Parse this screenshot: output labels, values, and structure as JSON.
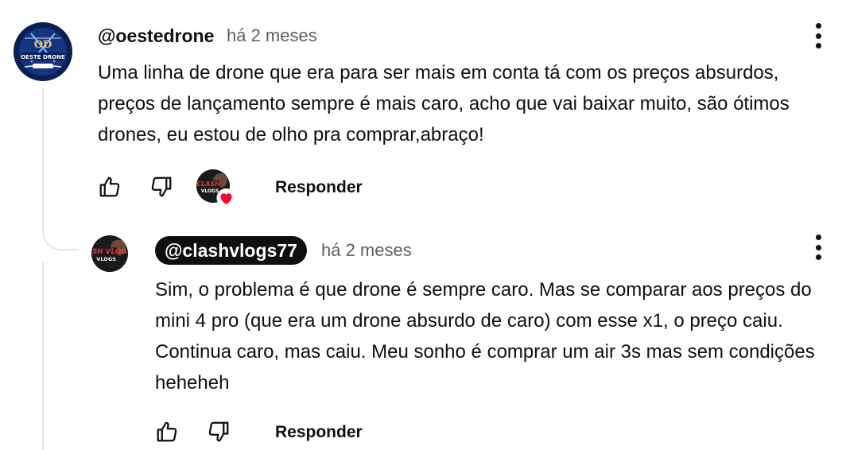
{
  "comment": {
    "handle": "@oestedrone",
    "time": "há 2 meses",
    "avatar_text": "OESTE DRONE",
    "text": "Uma linha de drone que era para ser mais em conta tá com os preços absurdos, preços de lançamento sempre é mais caro, acho que vai baixar muito,  são ótimos drones, eu estou de olho pra comprar,abraço!",
    "reply_label": "Responder",
    "heart_avatar_text": "CLASH VLOGS"
  },
  "reply": {
    "handle": "@clashvlogs77",
    "time": "há 2 meses",
    "avatar_text": "CLASH VLOGS",
    "text": "Sim, o problema é que drone é sempre caro. Mas se comparar aos preços do mini 4 pro (que era um drone absurdo de caro) com esse x1, o preço caiu. Continua caro, mas caiu. Meu sonho é comprar um air 3s mas sem condições heheheh",
    "reply_label": "Responder"
  },
  "icons": {
    "like": "thumbs-up-icon",
    "dislike": "thumbs-down-icon",
    "more": "more-vert-icon",
    "heart": "heart-icon"
  },
  "colors": {
    "text": "#0f0f0f",
    "secondary": "#606060",
    "heart": "#ff0033",
    "thread_line": "#e5e5e5"
  }
}
